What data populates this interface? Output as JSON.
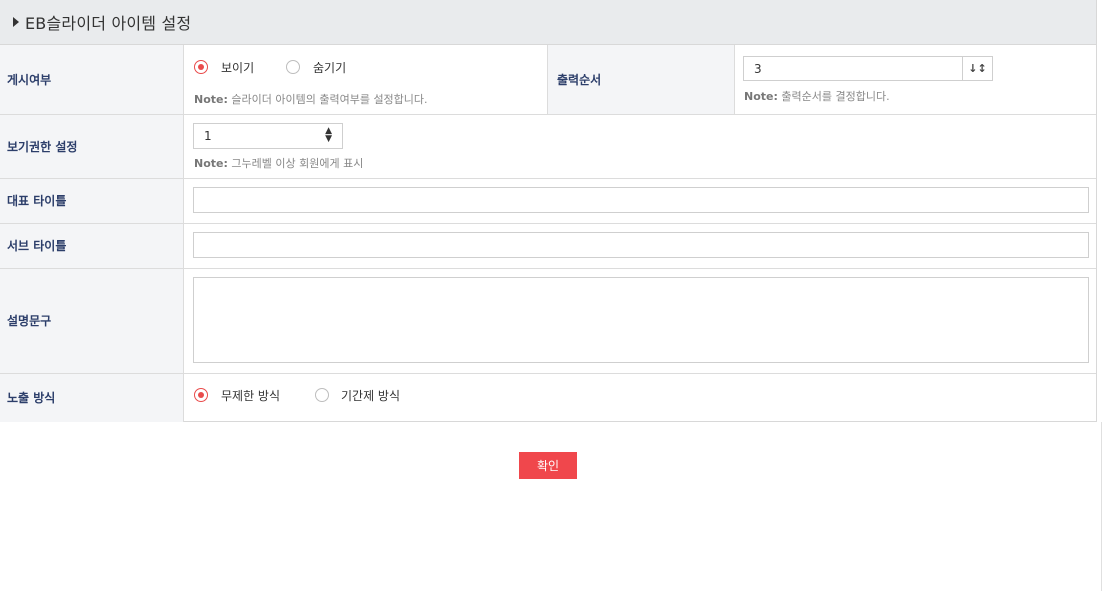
{
  "header": {
    "title": "EB슬라이더 아이템 설정"
  },
  "visibility": {
    "label": "게시여부",
    "options": [
      "보이기",
      "숨기기"
    ],
    "selected": "보이기",
    "note_prefix": "Note:",
    "note": "슬라이더 아이템의 출력여부를 설정합니다."
  },
  "order": {
    "label": "출력순서",
    "value": "3",
    "sort_icon": "↓↕",
    "note_prefix": "Note:",
    "note": "출력순서를 결정합니다."
  },
  "permission": {
    "label": "보기권한 설정",
    "value": "1",
    "note_prefix": "Note:",
    "note": "그누레벨 이상 회원에게 표시"
  },
  "main_title": {
    "label": "대표 타이틀",
    "value": ""
  },
  "sub_title": {
    "label": "서브 타이틀",
    "value": ""
  },
  "description": {
    "label": "설명문구",
    "value": ""
  },
  "exposure": {
    "label": "노출 방식",
    "options": [
      "무제한 방식",
      "기간제 방식"
    ],
    "selected": "무제한 방식"
  },
  "confirm_button": {
    "label": "확인"
  },
  "colors": {
    "accent": "#f0474c",
    "label_text": "#2c3e6a",
    "label_bg": "#f4f5f7"
  }
}
